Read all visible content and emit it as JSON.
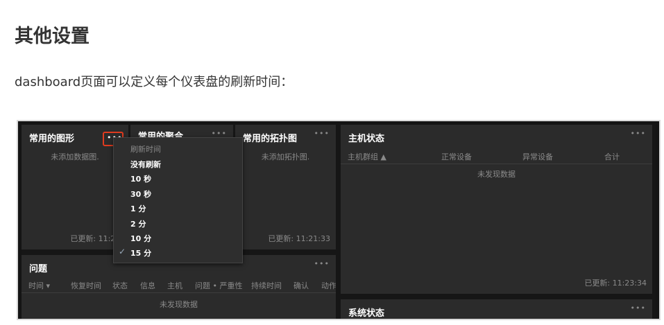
{
  "article": {
    "heading": "其他设置",
    "description": "dashboard页面可以定义每个仪表盘的刷新时间："
  },
  "screenshot": {
    "panel_menu_dots": "•••",
    "panels": {
      "graphs": {
        "title": "常用的图形",
        "empty": "未添加数据图.",
        "updated": "已更新: 11:21:"
      },
      "aggregates": {
        "title": "常用的聚合"
      },
      "topology": {
        "title": "常用的拓扑图",
        "empty": "未添加拓扑图.",
        "updated": "已更新: 11:21:33"
      },
      "host_status": {
        "title": "主机状态",
        "columns": [
          "主机群组 ▲",
          "正常设备",
          "异常设备",
          "合计"
        ],
        "empty": "未发现数据",
        "updated": "已更新: 11:23:34"
      },
      "problems": {
        "title": "问题",
        "columns": [
          "时间 ▾",
          "恢复时间",
          "状态",
          "信息",
          "主机",
          "问题 • 严重性",
          "持续时间",
          "确认",
          "动作"
        ],
        "empty": "未发现数据"
      },
      "system_status": {
        "title": "系统状态"
      }
    },
    "refresh_menu": {
      "header": "刷新时间",
      "items": [
        "没有刷新",
        "10 秒",
        "30 秒",
        "1 分",
        "2 分",
        "10 分",
        "15 分"
      ],
      "selected": "15 分",
      "check_icon": "✓"
    }
  }
}
